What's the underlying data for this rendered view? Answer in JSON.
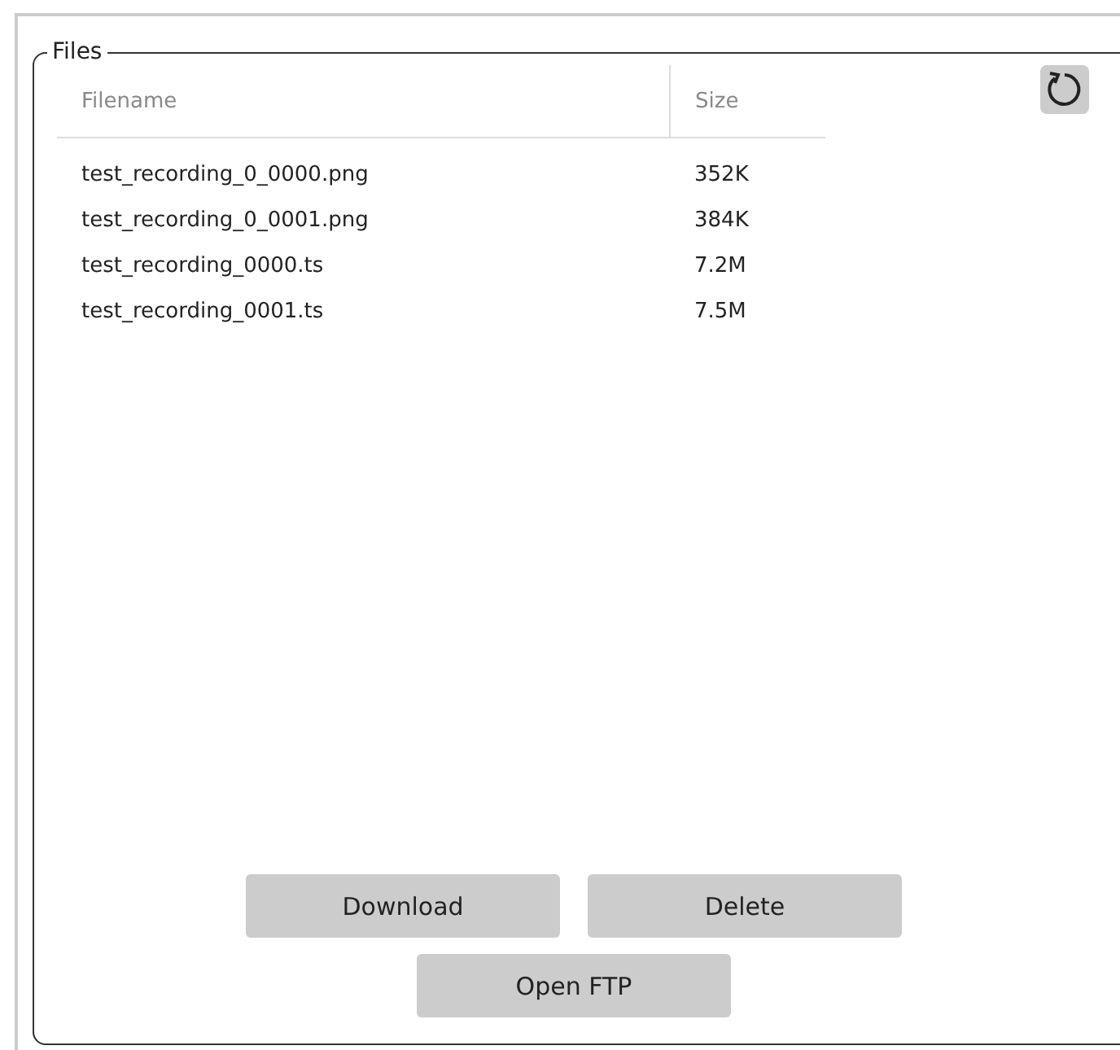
{
  "panel": {
    "title": "Files"
  },
  "table": {
    "columns": [
      "Filename",
      "Size"
    ],
    "rows": [
      {
        "filename": "test_recording_0_0000.png",
        "size": "352K"
      },
      {
        "filename": "test_recording_0_0001.png",
        "size": "384K"
      },
      {
        "filename": "test_recording_0000.ts",
        "size": "7.2M"
      },
      {
        "filename": "test_recording_0001.ts",
        "size": "7.5M"
      }
    ]
  },
  "buttons": [
    [
      "Download",
      "Delete"
    ],
    [
      "Open FTP"
    ]
  ]
}
